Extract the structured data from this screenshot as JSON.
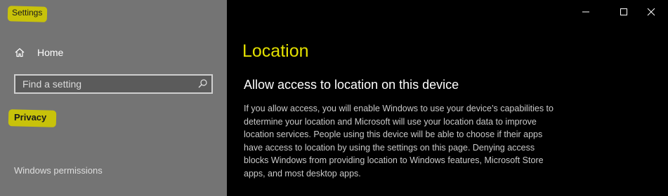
{
  "window": {
    "title": "Settings"
  },
  "sidebar": {
    "home_label": "Home",
    "search_placeholder": "Find a setting",
    "category": "Privacy",
    "section_label": "Windows permissions"
  },
  "main": {
    "page_title": "Location",
    "section_title": "Allow access to location on this device",
    "description": "If you allow access, you will enable Windows to use your device’s capabilities to determine your location and Microsoft will use your location data to improve location services. People using this device will be able to choose if their apps have access to location by using the settings on this page. Denying access blocks Windows from providing location to Windows features, Microsoft Store apps, and most desktop apps."
  },
  "colors": {
    "sidebar_bg": "#747474",
    "main_bg": "#000000",
    "highlight": "#c8c20a",
    "page_title_accent": "#e3e000"
  },
  "icons": [
    "home-icon",
    "search-icon",
    "minimize-icon",
    "maximize-icon",
    "close-icon"
  ]
}
